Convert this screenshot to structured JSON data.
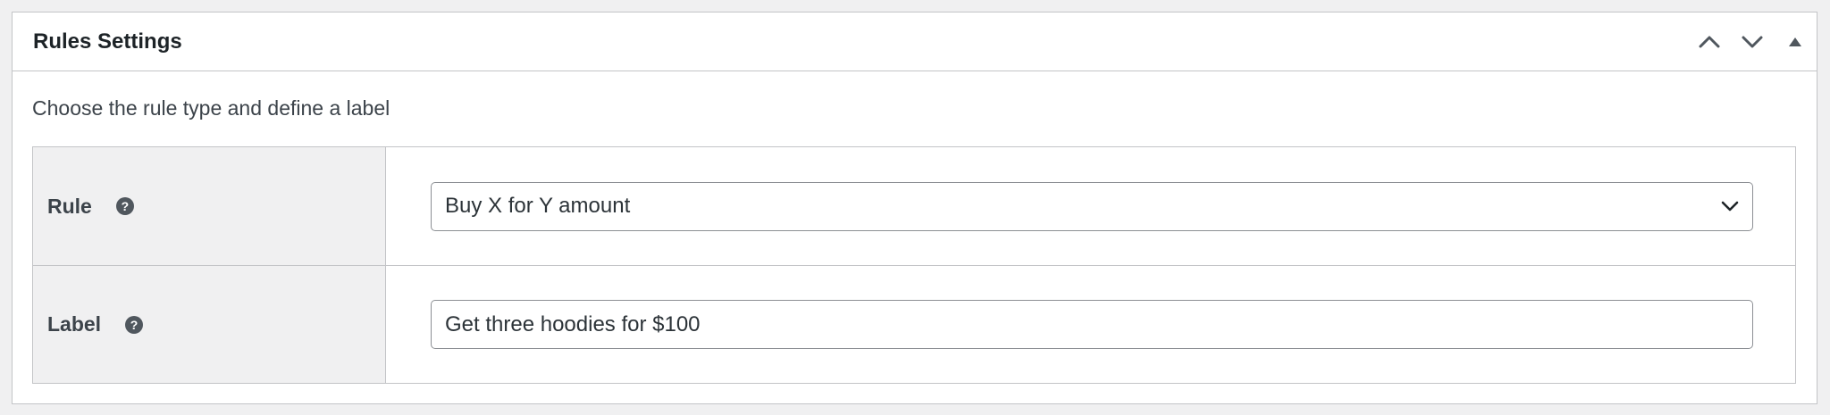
{
  "postbox": {
    "title": "Rules Settings",
    "actions": [
      "move-up-icon",
      "move-down-icon",
      "toggle-panel-icon"
    ]
  },
  "description": "Choose the rule type and define a label",
  "fields": {
    "rule": {
      "label": "Rule",
      "help_icon": "?",
      "selected": "Buy X for Y amount"
    },
    "label": {
      "label": "Label",
      "help_icon": "?",
      "value": "Get three hoodies for $100"
    }
  },
  "colors": {
    "border": "#c3c4c7",
    "label_bg": "#f0f0f1",
    "text": "#1d2327",
    "icon": "#50575e"
  }
}
